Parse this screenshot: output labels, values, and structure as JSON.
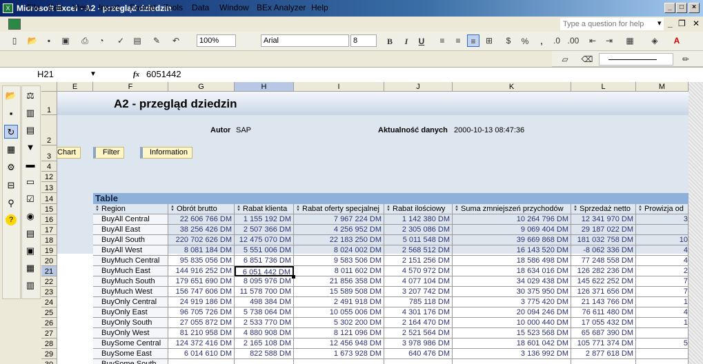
{
  "window": {
    "title": "Microsoft Excel - A2 - przegląd dziedzin",
    "app_icon": "excel-icon"
  },
  "menu": [
    "File",
    "Edit",
    "View",
    "Insert",
    "Format",
    "Tools",
    "Data",
    "Window",
    "BEx Analyzer",
    "Help"
  ],
  "help_placeholder": "Type a question for help",
  "toolbar": {
    "zoom": "100%",
    "font": "Arial",
    "size": "8",
    "bold": "B",
    "italic": "I",
    "underline": "U",
    "percent": "%",
    "comma": ","
  },
  "formula": {
    "name_box": "H21",
    "fx": "fx",
    "value": "6051442"
  },
  "columns": [
    "E",
    "F",
    "G",
    "H",
    "I",
    "J",
    "K",
    "L",
    "M"
  ],
  "selected_column": "H",
  "rows": [
    "1",
    "2",
    "3",
    "4",
    "12",
    "13",
    "14",
    "15",
    "16",
    "17",
    "18",
    "19",
    "20",
    "21",
    "22",
    "23",
    "24",
    "25",
    "26",
    "27",
    "28",
    "29",
    "30"
  ],
  "report": {
    "title": "A2 - przegląd dziedzin",
    "author_label": "Autor",
    "author": "SAP",
    "date_label": "Aktualność danych",
    "date": "2000-10-13 08:47:36",
    "buttons": [
      "Chart",
      "Filter",
      "Information"
    ]
  },
  "table": {
    "caption": "Table",
    "headers": [
      "Region",
      "Obrót brutto",
      "Rabat klienta",
      "Rabat oferty specjalnej",
      "Rabat ilościowy",
      "Suma zmniejszeń przychodów",
      "Sprzedaż netto",
      "Prowizja od"
    ],
    "rows": [
      [
        "BuyAll Central",
        "22 606 766 DM",
        "1 155 192 DM",
        "7 967 224 DM",
        "1 142 380 DM",
        "10 264 796 DM",
        "12 341 970 DM",
        "3"
      ],
      [
        "BuyAll East",
        "38 256 426 DM",
        "2 507 366 DM",
        "4 256 952 DM",
        "2 305 086 DM",
        "9 069 404 DM",
        "29 187 022 DM",
        ""
      ],
      [
        "BuyAll South",
        "220 702 626 DM",
        "12 475 070 DM",
        "22 183 250 DM",
        "5 011 548 DM",
        "39 669 868 DM",
        "181 032 758 DM",
        "10"
      ],
      [
        "BuyAll West",
        "8 081 184 DM",
        "5 551 006 DM",
        "8 024 002 DM",
        "2 568 512 DM",
        "16 143 520 DM",
        "-8 062 336 DM",
        "4"
      ],
      [
        "BuyMuch Central",
        "95 835 056 DM",
        "6 851 736 DM",
        "9 583 506 DM",
        "2 151 256 DM",
        "18 586 498 DM",
        "77 248 558 DM",
        "4"
      ],
      [
        "BuyMuch East",
        "144 916 252 DM",
        "6 051 442 DM",
        "8 011 602 DM",
        "4 570 972 DM",
        "18 634 016 DM",
        "126 282 236 DM",
        "2"
      ],
      [
        "BuyMuch South",
        "179 651 690 DM",
        "8 095 976 DM",
        "21 856 358 DM",
        "4 077 104 DM",
        "34 029 438 DM",
        "145 622 252 DM",
        "7"
      ],
      [
        "BuyMuch West",
        "156 747 606 DM",
        "11 578 700 DM",
        "15 589 508 DM",
        "3 207 742 DM",
        "30 375 950 DM",
        "126 371 656 DM",
        "7"
      ],
      [
        "BuyOnly Central",
        "24 919 186 DM",
        "498 384 DM",
        "2 491 918 DM",
        "785 118 DM",
        "3 775 420 DM",
        "21 143 766 DM",
        "1"
      ],
      [
        "BuyOnly East",
        "96 705 726 DM",
        "5 738 064 DM",
        "10 055 006 DM",
        "4 301 176 DM",
        "20 094 246 DM",
        "76 611 480 DM",
        "4"
      ],
      [
        "BuyOnly South",
        "27 055 872 DM",
        "2 533 770 DM",
        "5 302 200 DM",
        "2 164 470 DM",
        "10 000 440 DM",
        "17 055 432 DM",
        "1"
      ],
      [
        "BuyOnly West",
        "81 210 958 DM",
        "4 880 908 DM",
        "8 121 096 DM",
        "2 521 564 DM",
        "15 523 568 DM",
        "65 687 390 DM",
        ""
      ],
      [
        "BuySome Central",
        "124 372 416 DM",
        "2 165 108 DM",
        "12 456 948 DM",
        "3 978 986 DM",
        "18 601 042 DM",
        "105 771 374 DM",
        "5"
      ],
      [
        "BuySome East",
        "6 014 610 DM",
        "822 588 DM",
        "1 673 928 DM",
        "640 476 DM",
        "3 136 992 DM",
        "2 877 618 DM",
        ""
      ],
      [
        "BuySome South",
        "",
        "",
        "",
        "",
        "",
        "",
        ""
      ]
    ]
  },
  "colors": {
    "titlebar": "#0a246a",
    "table_caption": "#8fb0d8",
    "header_row": "#dfe7f1",
    "selection": "#000000"
  }
}
